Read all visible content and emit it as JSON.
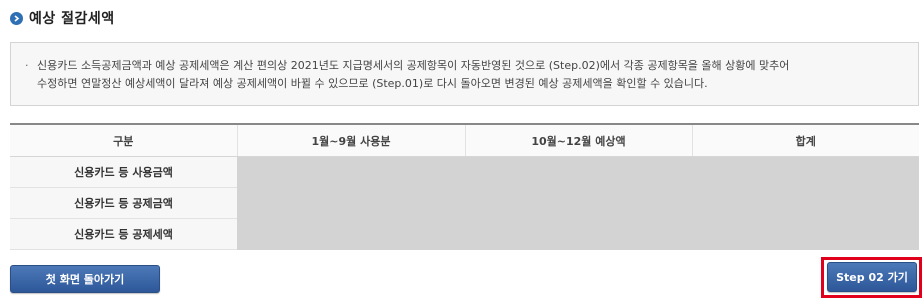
{
  "section": {
    "title": "예상 절감세액",
    "icon": "arrow-right-circle-icon"
  },
  "notice": {
    "bullet": "·",
    "line1": "신용카드 소득공제금액과 예상 공제세액은 계산 편의상 2021년도 지급명세서의 공제항목이 자동반영된 것으로 (Step.02)에서 각종 공제항목을 올해 상황에 맞추어",
    "line2": "수정하면 연말정산 예상세액이 달라져 예상 공제세액이 바뀔 수 있으므로 (Step.01)로 다시 돌아오면 변경된 예상 공제세액을 확인할 수 있습니다."
  },
  "table": {
    "headers": [
      "구분",
      "1월~9월 사용분",
      "10월~12월 예상액",
      "합계"
    ],
    "rows": [
      {
        "label": "신용카드 등 사용금액",
        "values": [
          "",
          "",
          ""
        ]
      },
      {
        "label": "신용카드 등 공제금액",
        "values": [
          "",
          "",
          ""
        ]
      },
      {
        "label": "신용카드 등 공제세액",
        "values": [
          "",
          "",
          ""
        ]
      }
    ]
  },
  "buttons": {
    "home_label": "첫 화면 돌아가기",
    "step2_label": "Step 02 가기"
  },
  "colors": {
    "accent": "#2f6fb3",
    "button": "#3a64a6",
    "highlight": "#e0001b",
    "value_cell": "#d3d3d3"
  }
}
